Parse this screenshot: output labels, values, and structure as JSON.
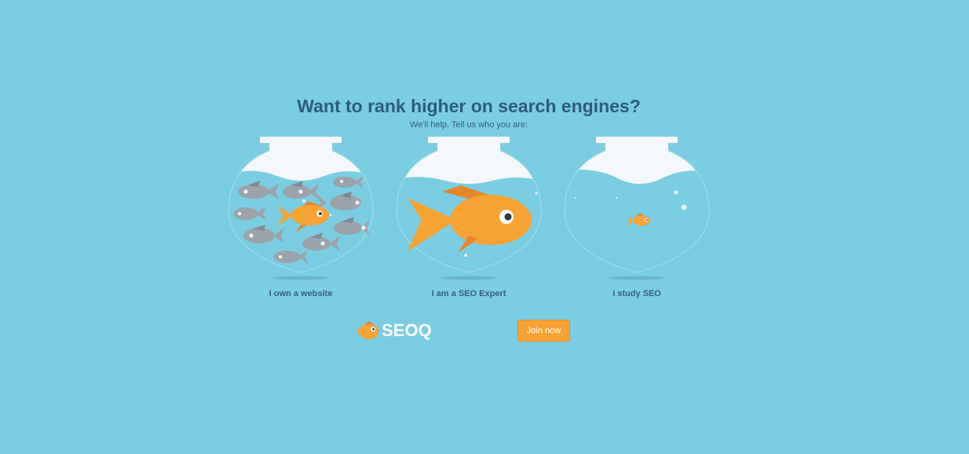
{
  "header": {
    "title": "Want to rank higher on search engines?",
    "subtitle": "We'll help. Tell us who you are:"
  },
  "options": [
    {
      "label": "I own a website",
      "icon": "fishbowl-crowded-icon"
    },
    {
      "label": "I am a SEO Expert",
      "icon": "fishbowl-big-fish-icon"
    },
    {
      "label": "I study SEO",
      "icon": "fishbowl-small-fish-icon"
    }
  ],
  "footer": {
    "logo_text": "SEOQ",
    "join_label": "Join now"
  },
  "colors": {
    "background": "#7bcde3",
    "title": "#2f5a7a",
    "accent": "#f7a334",
    "fish_gray": "#9aa3ab"
  }
}
